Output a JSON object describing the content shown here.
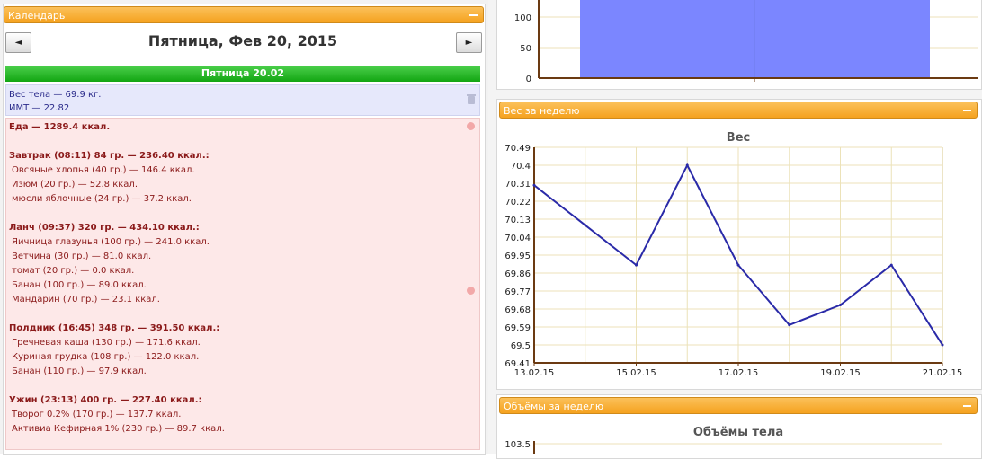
{
  "calendar": {
    "header": "Календарь",
    "prev_symbol": "◄",
    "next_symbol": "►",
    "date_title": "Пятница, Фев 20, 2015",
    "day_label": "Пятница 20.02",
    "weight_line": "Вес тела — 69.9 кг.",
    "bmi_line": "ИМТ — 22.82",
    "food_rows": [
      {
        "text": "Еда — 1289.4 ккал.",
        "kind": "meal"
      },
      {
        "text": "",
        "kind": "blank"
      },
      {
        "text": "Завтрак (08:11) 84 гр. — 236.40 ккал.:",
        "kind": "meal"
      },
      {
        "text": "Овсяные хлопья (40 гр.) — 146.4 ккал.",
        "kind": "item"
      },
      {
        "text": "Изюм (20 гр.) — 52.8 ккал.",
        "kind": "item"
      },
      {
        "text": "мюсли яблочные (24 гр.) — 37.2 ккал.",
        "kind": "item"
      },
      {
        "text": "",
        "kind": "blank"
      },
      {
        "text": "Ланч (09:37) 320 гр. — 434.10 ккал.:",
        "kind": "meal"
      },
      {
        "text": "Яичница глазунья (100 гр.) — 241.0 ккал.",
        "kind": "item"
      },
      {
        "text": "Ветчина (30 гр.) — 81.0 ккал.",
        "kind": "item"
      },
      {
        "text": "томат (20 гр.) — 0.0 ккал.",
        "kind": "item"
      },
      {
        "text": "Банан (100 гр.) — 89.0 ккал.",
        "kind": "item"
      },
      {
        "text": "Мандарин (70 гр.) — 23.1 ккал.",
        "kind": "item"
      },
      {
        "text": "",
        "kind": "blank"
      },
      {
        "text": "Полдник (16:45) 348 гр. — 391.50 ккал.:",
        "kind": "meal"
      },
      {
        "text": "Гречневая каша (130 гр.) — 171.6 ккал.",
        "kind": "item"
      },
      {
        "text": "Куриная грудка (108 гр.) — 122.0 ккал.",
        "kind": "item"
      },
      {
        "text": "Банан (110 гр.) — 97.9 ккал.",
        "kind": "item"
      },
      {
        "text": "",
        "kind": "blank"
      },
      {
        "text": "Ужин (23:13) 400 гр. — 227.40 ккал.:",
        "kind": "meal"
      },
      {
        "text": "Творог 0.2% (170 гр.) — 137.7 ккал.",
        "kind": "item"
      },
      {
        "text": "Активиа Кефирная 1% (230 гр.) — 89.7 ккал.",
        "kind": "item"
      }
    ]
  },
  "weight_panel": {
    "header": "Вес за неделю"
  },
  "volumes_panel": {
    "header": "Объёмы за неделю"
  },
  "colors": {
    "panel_orange": "#f5a21f",
    "day_green": "#12a512",
    "weight_line": "#2a2aa8",
    "bar_blue": "#7b86ff"
  },
  "chart_data": [
    {
      "type": "bar",
      "title": "",
      "y_ticks": [
        0,
        50,
        100
      ],
      "ylim": [
        0,
        150
      ],
      "categories": [
        ""
      ],
      "values": [
        150
      ],
      "note_partial": true
    },
    {
      "type": "line",
      "title": "Вес",
      "x": [
        "13.02.15",
        "14.02.15",
        "15.02.15",
        "16.02.15",
        "17.02.15",
        "18.02.15",
        "19.02.15",
        "20.02.15",
        "21.02.15"
      ],
      "x_tick_labels": [
        "13.02.15",
        "15.02.15",
        "17.02.15",
        "19.02.15",
        "21.02.15"
      ],
      "values": [
        70.3,
        70.1,
        69.9,
        70.4,
        69.9,
        69.6,
        69.7,
        69.9,
        69.5
      ],
      "y_tick_labels": [
        "70.49",
        "70.4",
        "70.31",
        "70.22",
        "70.13",
        "70.04",
        "69.95",
        "69.86",
        "69.77",
        "69.68",
        "69.59",
        "69.5",
        "69.41"
      ],
      "ylim": [
        69.41,
        70.49
      ],
      "grid": true
    },
    {
      "type": "line",
      "title": "Объёмы тела",
      "y_tick_labels": [
        "103.5"
      ]
    }
  ]
}
